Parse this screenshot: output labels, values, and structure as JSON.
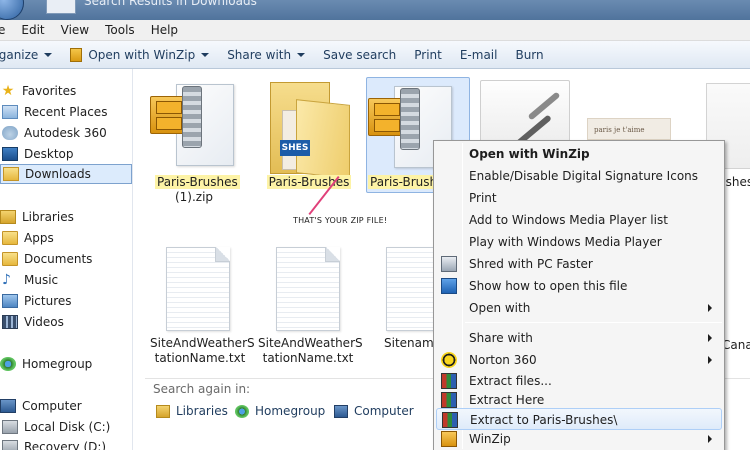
{
  "window": {
    "title": "Search Results in Downloads"
  },
  "menubar": [
    "Edit",
    "View",
    "Tools",
    "Help"
  ],
  "menubar_first": "e",
  "toolbar": {
    "organize": "rganize",
    "open_with": "Open with WinZip",
    "share_with": "Share with",
    "save_search": "Save search",
    "print": "Print",
    "email": "E-mail",
    "burn": "Burn"
  },
  "nav": {
    "favorites": "Favorites",
    "recent_places": "Recent Places",
    "autodesk": "Autodesk 360",
    "desktop": "Desktop",
    "downloads": "Downloads",
    "libraries": "Libraries",
    "apps": "Apps",
    "documents": "Documents",
    "music": "Music",
    "pictures": "Pictures",
    "videos": "Videos",
    "homegroup": "Homegroup",
    "computer": "Computer",
    "local_disk": "Local Disk (C:)",
    "recovery": "Recovery (D:)"
  },
  "files": {
    "zip1_line1": "Paris-Brushes",
    "zip1_line2": "(1).zip",
    "folder": "Paris-Brushes",
    "zip2": "Paris-Brush",
    "right_partial": "ushes",
    "txt1_line1": "SiteAndWeatherS",
    "txt1_line2": "tationName.txt",
    "txt2_line1": "SiteAndWeatherS",
    "txt2_line2": "tationName.txt",
    "txt3": "Sitename",
    "txt4": "Canad",
    "paris_card": "paris  je t'aime"
  },
  "annotation": "THAT'S YOUR ZIP FILE!",
  "search_again": {
    "label": "Search again in:",
    "libraries": "Libraries",
    "homegroup": "Homegroup",
    "computer": "Computer"
  },
  "context_menu": {
    "open_with_winzip": "Open with WinZip",
    "enable_disable": "Enable/Disable Digital Signature Icons",
    "print": "Print",
    "add_wmp": "Add to Windows Media Player list",
    "play_wmp": "Play with Windows Media Player",
    "shred": "Shred with PC Faster",
    "show_how": "Show how to open this file",
    "open_with": "Open with",
    "share_with": "Share with",
    "norton": "Norton 360",
    "extract_files": "Extract files...",
    "extract_here": "Extract Here",
    "extract_to": "Extract to Paris-Brushes\\",
    "winzip": "WinZip"
  },
  "colors": {
    "selection": "#dceafc",
    "highlight": "#fdf3a6",
    "annotation_line": "#e0407a"
  }
}
